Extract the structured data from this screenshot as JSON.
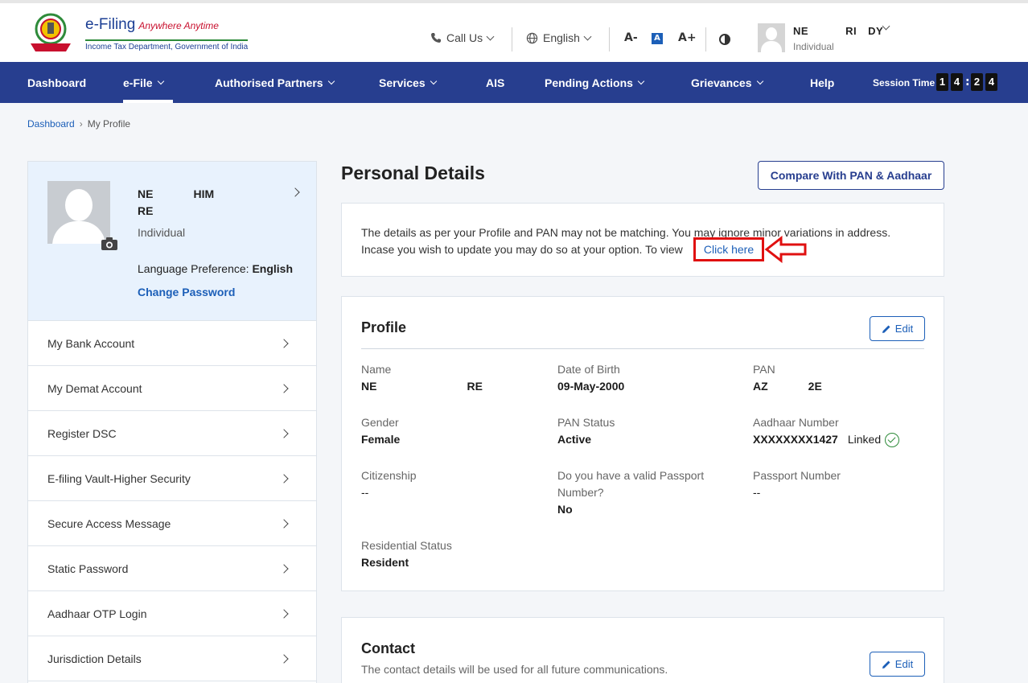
{
  "header": {
    "logo_title": "e-Filing",
    "logo_tagline": "Anywhere Anytime",
    "logo_sub": "Income Tax Department, Government of India",
    "call_us": "Call Us",
    "language": "English",
    "font_decrease": "A-",
    "font_normal": "A",
    "font_increase": "A+",
    "user_name_part1": "NE",
    "user_name_part2": "RI",
    "user_name_part3": "DY",
    "user_type": "Individual"
  },
  "nav": {
    "items": [
      {
        "label": "Dashboard",
        "dropdown": false
      },
      {
        "label": "e-File",
        "dropdown": true
      },
      {
        "label": "Authorised Partners",
        "dropdown": true
      },
      {
        "label": "Services",
        "dropdown": true
      },
      {
        "label": "AIS",
        "dropdown": false
      },
      {
        "label": "Pending Actions",
        "dropdown": true
      },
      {
        "label": "Grievances",
        "dropdown": true
      },
      {
        "label": "Help",
        "dropdown": false
      }
    ],
    "session_label": "Session Time",
    "session_digits": [
      "1",
      "4",
      "2",
      "4"
    ]
  },
  "breadcrumb": {
    "home": "Dashboard",
    "current": "My Profile"
  },
  "profile_card": {
    "name_part1": "NE",
    "name_part2": "HIM",
    "name_line2": "RE",
    "type": "Individual",
    "language_label": "Language Preference: ",
    "language_value": "English",
    "change_password": "Change Password"
  },
  "side_menu": [
    "My Bank Account",
    "My Demat Account",
    "Register DSC",
    "E-filing Vault-Higher Security",
    "Secure Access Message",
    "Static Password",
    "Aadhaar OTP Login",
    "Jurisdiction Details"
  ],
  "main": {
    "title": "Personal Details",
    "compare_button": "Compare With PAN & Aadhaar",
    "notice_text": "The details as per your Profile and PAN may not be matching. You may ignore minor variations in address. Incase you wish to update you may do so at your option. To view",
    "click_here": "Click here"
  },
  "profile": {
    "title": "Profile",
    "edit": "Edit",
    "name_label": "Name",
    "name_part1": "NE",
    "name_part2": "RE",
    "dob_label": "Date of Birth",
    "dob": "09-May-2000",
    "pan_label": "PAN",
    "pan_part1": "AZ",
    "pan_part2": "2E",
    "gender_label": "Gender",
    "gender": "Female",
    "pan_status_label": "PAN Status",
    "pan_status": "Active",
    "aadhaar_label": "Aadhaar Number",
    "aadhaar": "XXXXXXXX1427",
    "linked": "Linked",
    "citizenship_label": "Citizenship",
    "citizenship": "--",
    "passport_q_label": "Do you have a valid Passport Number?",
    "passport_q": "No",
    "passport_no_label": "Passport Number",
    "passport_no": "--",
    "residential_label": "Residential Status",
    "residential": "Resident"
  },
  "contact": {
    "title": "Contact",
    "edit": "Edit",
    "subtitle": "The contact details will be used for all future communications."
  },
  "colors": {
    "nav_bg": "#273e8f",
    "link": "#1c5fb8",
    "highlight": "#e01010",
    "linked": "#2e8b3a"
  }
}
